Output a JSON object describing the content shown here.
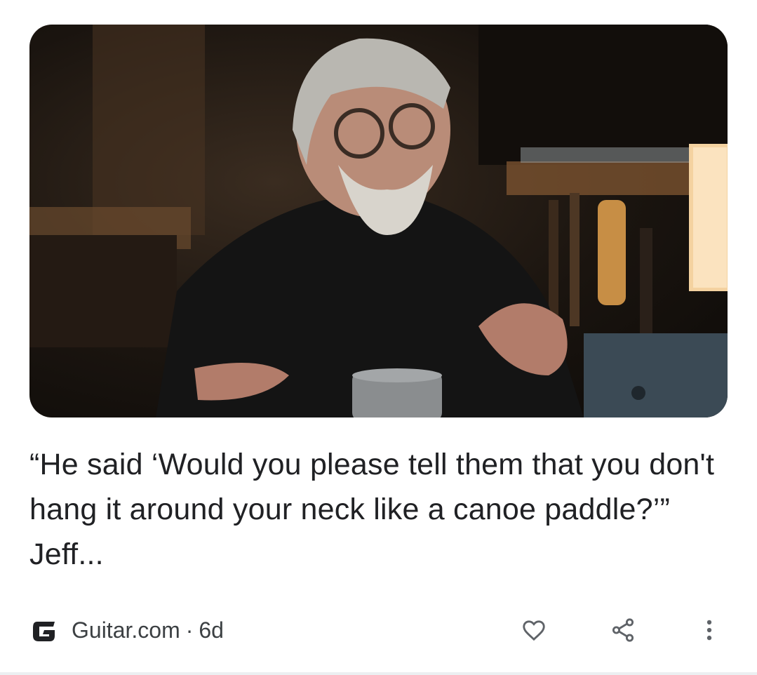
{
  "article": {
    "headline": "“He said ‘Would you please tell them that you don't hang it around your neck like a canoe paddle?’” Jeff...",
    "source": "Guitar.com",
    "separator": "·",
    "age": "6d",
    "thumbnail_icon": "photo-of-elderly-man-in-studio"
  },
  "actions": {
    "like_icon": "heart-icon",
    "share_icon": "share-icon",
    "more_icon": "more-vert-icon"
  },
  "colors": {
    "text_primary": "#202124",
    "text_secondary": "#3c4043",
    "icon": "#5f6368"
  }
}
